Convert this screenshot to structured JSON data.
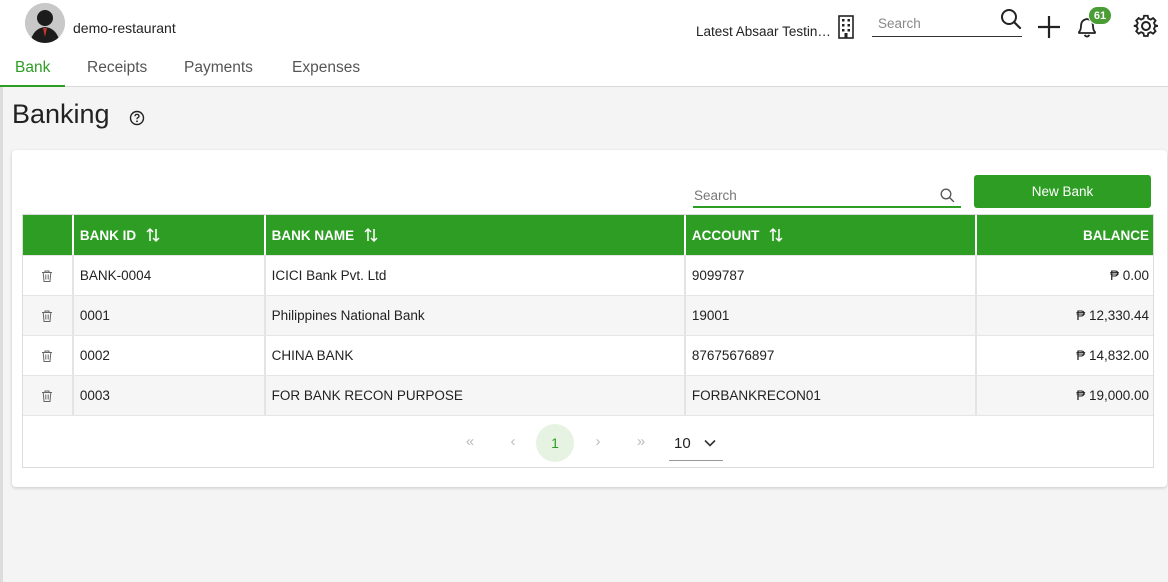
{
  "header": {
    "company_name": "demo-restaurant",
    "active_company": "Latest Absaar Testing Company",
    "search_placeholder": "Search",
    "notification_count": "61"
  },
  "tabs": [
    {
      "label": "Bank",
      "active": true
    },
    {
      "label": "Receipts",
      "active": false
    },
    {
      "label": "Payments",
      "active": false
    },
    {
      "label": "Expenses",
      "active": false
    }
  ],
  "page": {
    "title": "Banking",
    "search_placeholder": "Search",
    "new_button": "New Bank"
  },
  "table": {
    "columns": [
      "BANK ID",
      "BANK NAME",
      "ACCOUNT",
      "BALANCE"
    ],
    "rows": [
      {
        "id": "BANK-0004",
        "name": "ICICI Bank Pvt. Ltd",
        "account": "9099787",
        "balance": "₱ 0.00"
      },
      {
        "id": "0001",
        "name": "Philippines National Bank",
        "account": "19001",
        "balance": "₱ 12,330.44"
      },
      {
        "id": "0002",
        "name": "CHINA BANK",
        "account": "87675676897",
        "balance": "₱ 14,832.00"
      },
      {
        "id": "0003",
        "name": "FOR BANK RECON PURPOSE",
        "account": "FORBANKRECON01",
        "balance": "₱ 19,000.00"
      }
    ]
  },
  "pagination": {
    "current_page": "1",
    "page_size": "10",
    "first": "«",
    "prev": "‹",
    "next": "›",
    "last": "»"
  },
  "colors": {
    "accent": "#2e9d24",
    "badge": "#4a9c34"
  }
}
